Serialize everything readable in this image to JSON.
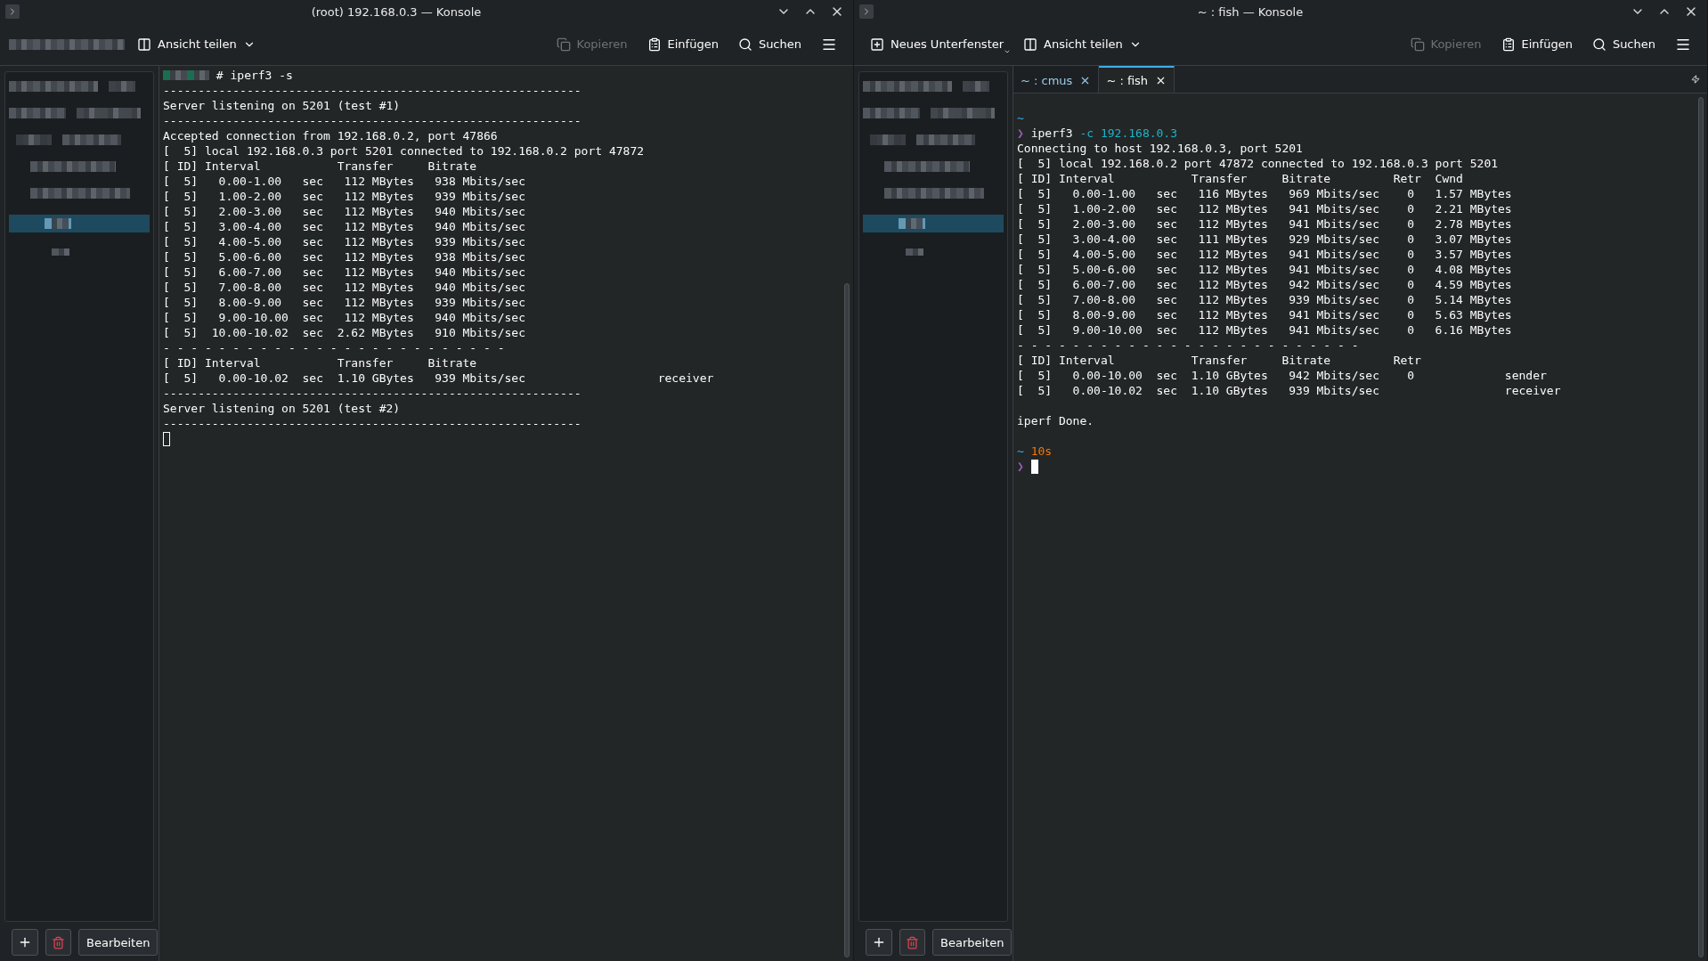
{
  "windows": [
    {
      "title": "(root) 192.168.0.3 — Konsole",
      "focused": false,
      "toolbar": {
        "left": [
          {
            "kind": "redacted"
          },
          {
            "kind": "split",
            "label": "Ansicht teilen",
            "disabled": false
          }
        ],
        "right": [
          {
            "kind": "copy",
            "label": "Kopieren",
            "disabled": true
          },
          {
            "kind": "paste",
            "label": "Einfügen",
            "disabled": false
          },
          {
            "kind": "search",
            "label": "Suchen",
            "disabled": false
          },
          {
            "kind": "menu",
            "disabled": false
          }
        ]
      },
      "sidebar": {
        "buttons": [
          {
            "kind": "add"
          },
          {
            "kind": "delete"
          },
          {
            "kind": "text",
            "label": "Bearbeiten"
          }
        ]
      },
      "terminal": {
        "lines": [
          {
            "kind": "root-prompt",
            "text": "# iperf3 -s"
          },
          {
            "kind": "text",
            "text": "------------------------------------------------------------"
          },
          {
            "kind": "text",
            "text": "Server listening on 5201 (test #1)"
          },
          {
            "kind": "text",
            "text": "------------------------------------------------------------"
          },
          {
            "kind": "text",
            "text": "Accepted connection from 192.168.0.2, port 47866"
          },
          {
            "kind": "text",
            "text": "[  5] local 192.168.0.3 port 5201 connected to 192.168.0.2 port 47872"
          },
          {
            "kind": "text",
            "text": "[ ID] Interval           Transfer     Bitrate"
          },
          {
            "kind": "text",
            "text": "[  5]   0.00-1.00   sec   112 MBytes   938 Mbits/sec"
          },
          {
            "kind": "text",
            "text": "[  5]   1.00-2.00   sec   112 MBytes   939 Mbits/sec"
          },
          {
            "kind": "text",
            "text": "[  5]   2.00-3.00   sec   112 MBytes   940 Mbits/sec"
          },
          {
            "kind": "text",
            "text": "[  5]   3.00-4.00   sec   112 MBytes   940 Mbits/sec"
          },
          {
            "kind": "text",
            "text": "[  5]   4.00-5.00   sec   112 MBytes   939 Mbits/sec"
          },
          {
            "kind": "text",
            "text": "[  5]   5.00-6.00   sec   112 MBytes   938 Mbits/sec"
          },
          {
            "kind": "text",
            "text": "[  5]   6.00-7.00   sec   112 MBytes   940 Mbits/sec"
          },
          {
            "kind": "text",
            "text": "[  5]   7.00-8.00   sec   112 MBytes   940 Mbits/sec"
          },
          {
            "kind": "text",
            "text": "[  5]   8.00-9.00   sec   112 MBytes   939 Mbits/sec"
          },
          {
            "kind": "text",
            "text": "[  5]   9.00-10.00  sec   112 MBytes   940 Mbits/sec"
          },
          {
            "kind": "text",
            "text": "[  5]  10.00-10.02  sec  2.62 MBytes   910 Mbits/sec"
          },
          {
            "kind": "text",
            "text": "- - - - - - - - - - - - - - - - - - - - - - - - -"
          },
          {
            "kind": "text",
            "text": "[ ID] Interval           Transfer     Bitrate"
          },
          {
            "kind": "text",
            "text": "[  5]   0.00-10.02  sec  1.10 GBytes   939 Mbits/sec                   receiver"
          },
          {
            "kind": "text",
            "text": "------------------------------------------------------------"
          },
          {
            "kind": "text",
            "text": "Server listening on 5201 (test #2)"
          },
          {
            "kind": "text",
            "text": "------------------------------------------------------------"
          },
          {
            "kind": "cursor"
          }
        ]
      }
    },
    {
      "title": "~ : fish — Konsole",
      "focused": true,
      "toolbar": {
        "left": [
          {
            "kind": "new-tab",
            "label": "Neues Unterfenster",
            "disabled": false
          },
          {
            "kind": "split",
            "label": "Ansicht teilen",
            "disabled": false
          }
        ],
        "right": [
          {
            "kind": "copy",
            "label": "Kopieren",
            "disabled": true
          },
          {
            "kind": "paste",
            "label": "Einfügen",
            "disabled": false
          },
          {
            "kind": "search",
            "label": "Suchen",
            "disabled": false
          },
          {
            "kind": "menu",
            "disabled": false
          }
        ]
      },
      "tabs": [
        {
          "label": "~ : cmus",
          "selected": false
        },
        {
          "label": "~ : fish",
          "selected": true
        }
      ],
      "sidebar": {
        "buttons": [
          {
            "kind": "add"
          },
          {
            "kind": "delete"
          },
          {
            "kind": "text",
            "label": "Bearbeiten"
          }
        ]
      },
      "terminal": {
        "lines": [
          {
            "kind": "blank"
          },
          {
            "kind": "spans",
            "spans": [
              {
                "text": "~",
                "kind": "dir"
              }
            ]
          },
          {
            "kind": "spans",
            "spans": [
              {
                "text": "❯ ",
                "kind": "symbol"
              },
              {
                "text": "iperf3",
                "kind": "plain"
              },
              {
                "text": " -c 192.168.0.3",
                "kind": "arg"
              }
            ]
          },
          {
            "kind": "text",
            "text": "Connecting to host 192.168.0.3, port 5201"
          },
          {
            "kind": "text",
            "text": "[  5] local 192.168.0.2 port 47872 connected to 192.168.0.3 port 5201"
          },
          {
            "kind": "text",
            "text": "[ ID] Interval           Transfer     Bitrate         Retr  Cwnd"
          },
          {
            "kind": "text",
            "text": "[  5]   0.00-1.00   sec   116 MBytes   969 Mbits/sec    0   1.57 MBytes"
          },
          {
            "kind": "text",
            "text": "[  5]   1.00-2.00   sec   112 MBytes   941 Mbits/sec    0   2.21 MBytes"
          },
          {
            "kind": "text",
            "text": "[  5]   2.00-3.00   sec   112 MBytes   941 Mbits/sec    0   2.78 MBytes"
          },
          {
            "kind": "text",
            "text": "[  5]   3.00-4.00   sec   111 MBytes   929 Mbits/sec    0   3.07 MBytes"
          },
          {
            "kind": "text",
            "text": "[  5]   4.00-5.00   sec   112 MBytes   941 Mbits/sec    0   3.57 MBytes"
          },
          {
            "kind": "text",
            "text": "[  5]   5.00-6.00   sec   112 MBytes   941 Mbits/sec    0   4.08 MBytes"
          },
          {
            "kind": "text",
            "text": "[  5]   6.00-7.00   sec   112 MBytes   942 Mbits/sec    0   4.59 MBytes"
          },
          {
            "kind": "text",
            "text": "[  5]   7.00-8.00   sec   112 MBytes   939 Mbits/sec    0   5.14 MBytes"
          },
          {
            "kind": "text",
            "text": "[  5]   8.00-9.00   sec   112 MBytes   941 Mbits/sec    0   5.63 MBytes"
          },
          {
            "kind": "text",
            "text": "[  5]   9.00-10.00  sec   112 MBytes   941 Mbits/sec    0   6.16 MBytes"
          },
          {
            "kind": "text",
            "text": "- - - - - - - - - - - - - - - - - - - - - - - - -"
          },
          {
            "kind": "text",
            "text": "[ ID] Interval           Transfer     Bitrate         Retr"
          },
          {
            "kind": "text",
            "text": "[  5]   0.00-10.00  sec  1.10 GBytes   942 Mbits/sec    0             sender"
          },
          {
            "kind": "text",
            "text": "[  5]   0.00-10.02  sec  1.10 GBytes   939 Mbits/sec                  receiver"
          },
          {
            "kind": "blank"
          },
          {
            "kind": "text",
            "text": "iperf Done."
          },
          {
            "kind": "blank"
          },
          {
            "kind": "spans",
            "spans": [
              {
                "text": "~",
                "kind": "dir"
              },
              {
                "text": " 10s",
                "kind": "duration"
              }
            ]
          },
          {
            "kind": "spans",
            "spans": [
              {
                "text": "❯ ",
                "kind": "symbol"
              }
            ],
            "cursor": true
          }
        ]
      }
    }
  ]
}
